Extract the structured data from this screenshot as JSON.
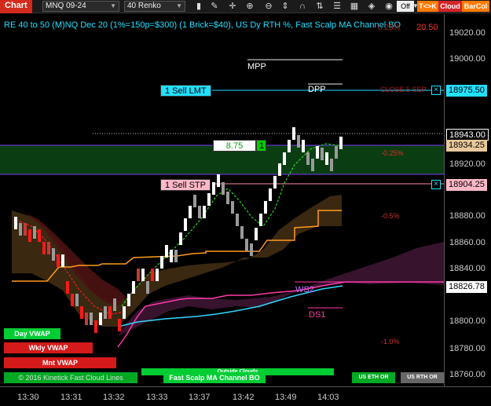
{
  "toolbar": {
    "title": "Chart",
    "instrument": "MNQ 09-24",
    "interval": "40 Renko",
    "off_label": "Off",
    "btn_tck": "T<>K",
    "btn_cloud": "Cloud",
    "btn_barcol": "BarCol"
  },
  "header": {
    "text": "RE 40 to 50 (M)NQ Dec 20 (1%=150p=$300) (1 Brick=$40), US Dy RTH %, Fast Scalp MA Channel BO",
    "pct_top": "0.25%",
    "value_top": "20.50"
  },
  "labels": {
    "mpp": "MPP",
    "dpp": "DPP",
    "close_5sep": "CLOSE 5 SEP",
    "pct_neg025": "-0.25%",
    "pct_neg05": "-0.5%",
    "pct_neg10": "-1.0%",
    "ws2": "WS2",
    "ds1": "DS1"
  },
  "orders": {
    "sell_lmt": "1 Sell LMT",
    "sell_stp": "1 Sell STP",
    "pnl_value": "8.75",
    "pnl_qty": "1"
  },
  "price_axis": {
    "ticks": [
      "19020.00",
      "19000.00",
      "18920.00",
      "18880.00",
      "18860.00",
      "18840.00",
      "18800.00",
      "18780.00",
      "18760.00"
    ],
    "label_sell_lmt": "18975.50",
    "label_last": "18943.00",
    "label_avg": "18934.25",
    "label_sell_stp": "18904.25",
    "label_ws2": "18826.78"
  },
  "time_axis": {
    "ticks": [
      "13:30",
      "13:31",
      "13:32",
      "13:33",
      "13:37",
      "13:42",
      "13:49",
      "14:03"
    ]
  },
  "legend": {
    "day_vwap": "Day VWAP",
    "wkly_vwap": "Wkly VWAP",
    "mnt_vwap": "Mnt VWAP",
    "copyright": "© 2016 Kinetick Fast Cloud Lines",
    "fast_scalp": "Fast Scalp MA Channel BO",
    "outside_clouds": "Outside Clouds",
    "us_eth_or": "US ETH OR",
    "us_rth_or": "US RTH OR"
  },
  "colors": {
    "bull_brick": "#ffffff",
    "bear_brick": "#ff1a1a",
    "bull_dim": "#9a9a9a",
    "bear_dim": "#c43a3a",
    "accent_cyan": "#22e0ff",
    "order_green": "#00cc00",
    "orange_line": "#ff9a1f",
    "magenta_line": "#ff3aa8",
    "cyan_line": "#34d6ff"
  }
}
